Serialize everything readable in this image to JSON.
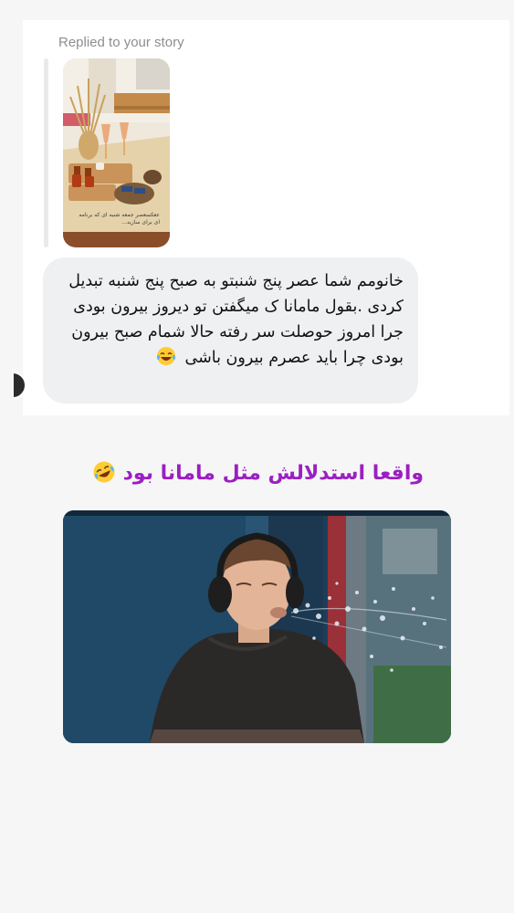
{
  "dm": {
    "replied_label": "Replied to your story",
    "story": {
      "caption": "ععکسعصر جمعه شنبه ای که برنامه ای برای سازید..."
    },
    "message": {
      "text": "خانومم شما عصر پنج شنبتو به صبح پنج شنبه تبدیل کردی  .بقول مامانا ک میگفتن تو دیروز بیرون بودی جرا امروز حوصلت سر رفته حالا شمام صبح بیرون بودی چرا باید عصرم بیرون باشی",
      "emoji": "face-with-tears-of-joy-emoji"
    }
  },
  "caption": {
    "text": "واقعا استدلالش مثل مامانا بود",
    "emoji": "rolling-on-floor-laughing-emoji",
    "color": "#9b1fc1"
  },
  "meme": {
    "description": "man-with-headphones-spitting-water"
  },
  "colors": {
    "page_background": "#f6f6f6",
    "panel_background": "#ffffff",
    "bubble_background": "#eff0f2",
    "muted_text": "#8e8e8e"
  }
}
